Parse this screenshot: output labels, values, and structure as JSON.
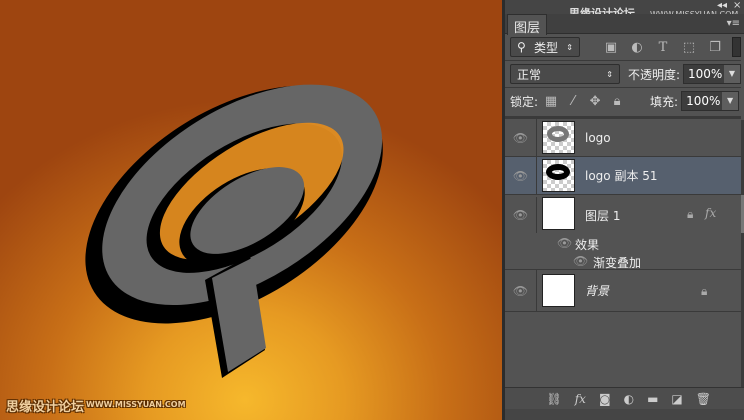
{
  "watermark": {
    "site_cn": "思缘设计论坛",
    "site_url": "WWW.MISSYUAN.COM"
  },
  "panel": {
    "controls": {
      "collapse": "◂◂",
      "close": "×"
    },
    "tab": "图层",
    "filter": {
      "label": "类型",
      "icons": [
        "image-filter-icon",
        "adjustment-filter-icon",
        "type-filter-icon",
        "shape-filter-icon",
        "smart-object-filter-icon"
      ]
    },
    "blend_mode": "正常",
    "opacity_label": "不透明度:",
    "opacity": "100%",
    "lock_label": "锁定:",
    "fill_label": "填充:",
    "fill": "100%",
    "layers": [
      {
        "name": "logo",
        "selected": false
      },
      {
        "name": "logo 副本 51",
        "selected": true
      },
      {
        "name": "图层 1",
        "fx": "fx",
        "effects_label": "效果",
        "effect": "渐变叠加"
      },
      {
        "name": "背景",
        "locked": true
      }
    ],
    "bottom_fx": "fx"
  },
  "colors": {
    "selected_row": "#56606e",
    "panel_bg": "#535353"
  }
}
